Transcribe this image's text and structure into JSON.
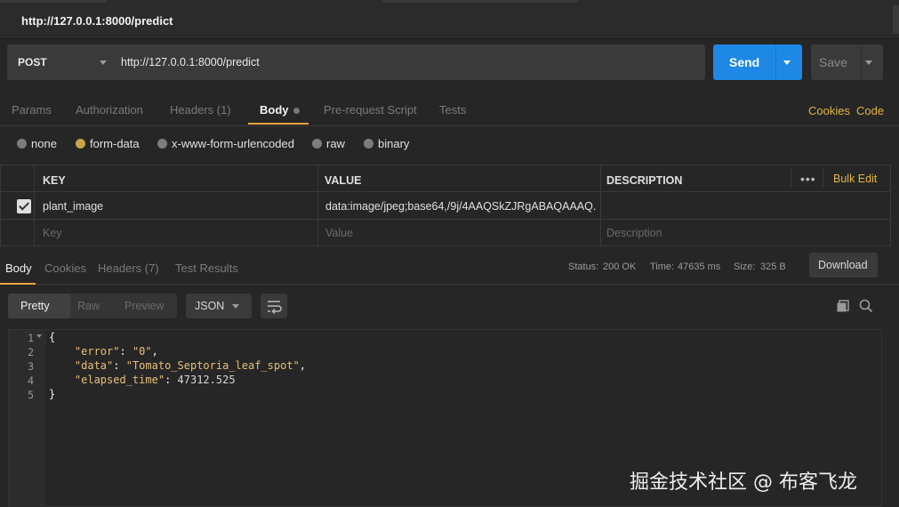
{
  "window": {
    "title": "http://127.0.0.1:8000/predict"
  },
  "request": {
    "method": "POST",
    "url": "http://127.0.0.1:8000/predict",
    "send_label": "Send",
    "save_label": "Save"
  },
  "request_tabs": {
    "items": [
      "Params",
      "Authorization",
      "Headers (1)",
      "Body",
      "Pre-request Script",
      "Tests"
    ],
    "active": "Body",
    "cookies": "Cookies",
    "code": "Code"
  },
  "body_types": {
    "items": [
      "none",
      "form-data",
      "x-www-form-urlencoded",
      "raw",
      "binary"
    ],
    "selected": "form-data"
  },
  "kv_table": {
    "headers": {
      "key": "KEY",
      "value": "VALUE",
      "description": "DESCRIPTION"
    },
    "bulk_edit": "Bulk Edit",
    "more": "•••",
    "rows": [
      {
        "checked": true,
        "key": "plant_image",
        "value": "data:image/jpeg;base64,/9j/4AAQSkZJRgABAQAAAQ...",
        "description": ""
      }
    ],
    "placeholders": {
      "key": "Key",
      "value": "Value",
      "description": "Description"
    }
  },
  "response_tabs": {
    "items": [
      "Body",
      "Cookies",
      "Headers (7)",
      "Test Results"
    ],
    "active": "Body"
  },
  "response_status": {
    "status_label": "Status:",
    "status": "200 OK",
    "time_label": "Time:",
    "time": "47635 ms",
    "size_label": "Size:",
    "size": "325 B",
    "download": "Download"
  },
  "view": {
    "modes": [
      "Pretty",
      "Raw",
      "Preview"
    ],
    "active": "Pretty",
    "format": "JSON"
  },
  "code": {
    "line_numbers": [
      "1",
      "2",
      "3",
      "4",
      "5"
    ],
    "lines": [
      {
        "open": "{"
      },
      {
        "key": "\"error\"",
        "sep": ": ",
        "val": "\"0\"",
        "end": ","
      },
      {
        "key": "\"data\"",
        "sep": ": ",
        "val": "\"Tomato_Septoria_leaf_spot\"",
        "end": ","
      },
      {
        "key": "\"elapsed_time\"",
        "sep": ": ",
        "val": "47312.525",
        "end": ""
      },
      {
        "open": "}"
      }
    ]
  },
  "watermark": "掘金技术社区 @ 布客飞龙"
}
